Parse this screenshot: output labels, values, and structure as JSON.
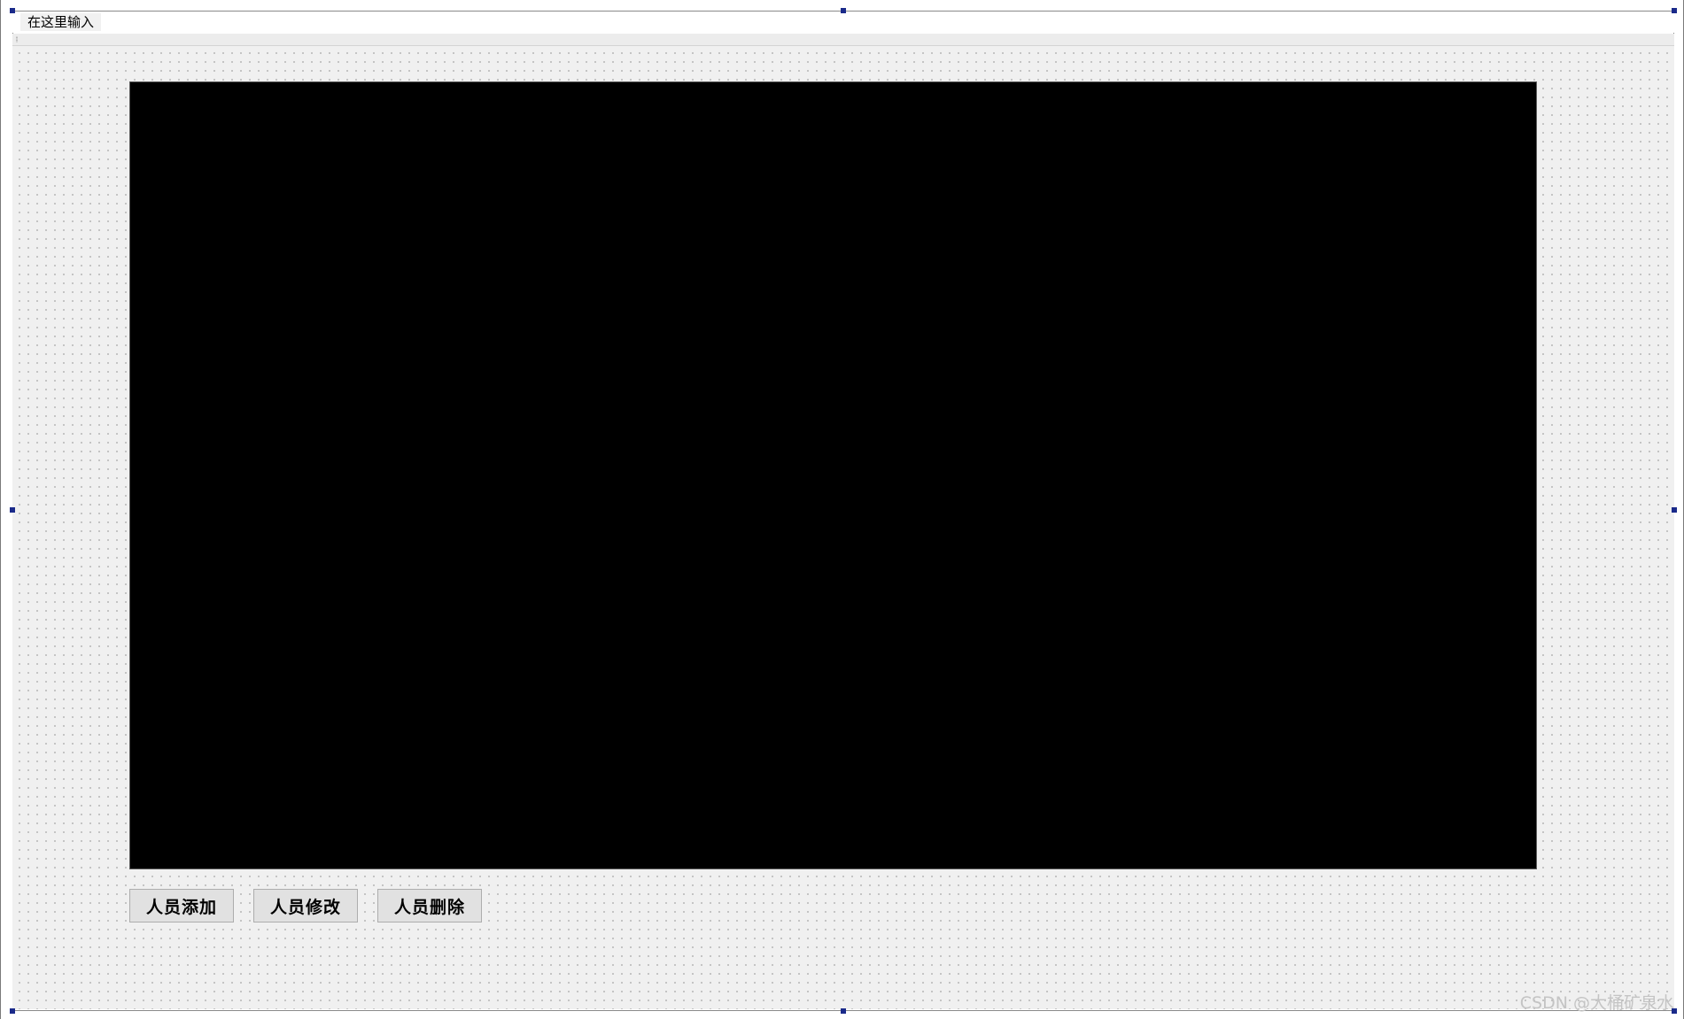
{
  "menubar": {
    "placeholder_entry": "在这里输入"
  },
  "buttons": {
    "add_person": "人员添加",
    "edit_person": "人员修改",
    "delete_person": "人员删除"
  },
  "watermark": "CSDN @大桶矿泉水",
  "colors": {
    "canvas_bg": "#f0f0f0",
    "video_bg": "#000000",
    "selection_handle": "#1a2a8a",
    "button_bg": "#e1e1e1"
  }
}
